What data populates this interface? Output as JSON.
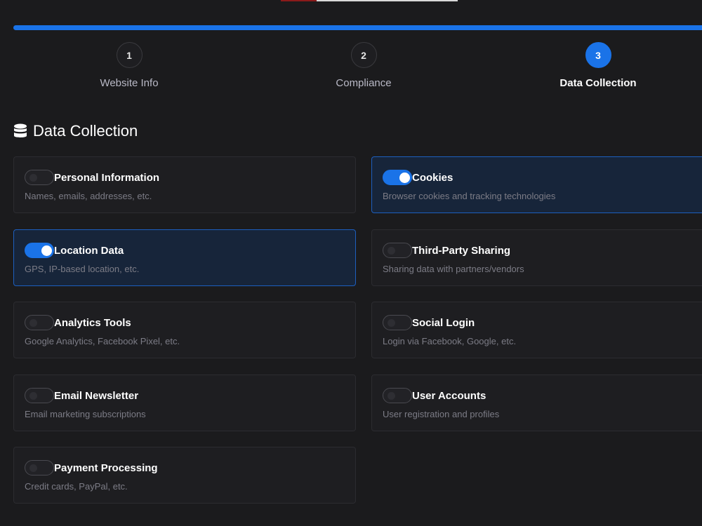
{
  "steps": [
    {
      "number": "1",
      "label": "Website Info",
      "active": false
    },
    {
      "number": "2",
      "label": "Compliance",
      "active": false
    },
    {
      "number": "3",
      "label": "Data Collection",
      "active": true
    }
  ],
  "progress_percent": 100,
  "section": {
    "title": "Data Collection",
    "icon": "database-icon"
  },
  "colors": {
    "accent": "#1a73e8",
    "background": "#1b1b1d",
    "card_on": "#17253a"
  },
  "options": [
    {
      "title": "Personal Information",
      "desc": "Names, emails, addresses, etc.",
      "enabled": false
    },
    {
      "title": "Cookies",
      "desc": "Browser cookies and tracking technologies",
      "enabled": true
    },
    {
      "title": "Location Data",
      "desc": "GPS, IP-based location, etc.",
      "enabled": true
    },
    {
      "title": "Third-Party Sharing",
      "desc": "Sharing data with partners/vendors",
      "enabled": false
    },
    {
      "title": "Analytics Tools",
      "desc": "Google Analytics, Facebook Pixel, etc.",
      "enabled": false
    },
    {
      "title": "Social Login",
      "desc": "Login via Facebook, Google, etc.",
      "enabled": false
    },
    {
      "title": "Email Newsletter",
      "desc": "Email marketing subscriptions",
      "enabled": false
    },
    {
      "title": "User Accounts",
      "desc": "User registration and profiles",
      "enabled": false
    },
    {
      "title": "Payment Processing",
      "desc": "Credit cards, PayPal, etc.",
      "enabled": false
    }
  ]
}
